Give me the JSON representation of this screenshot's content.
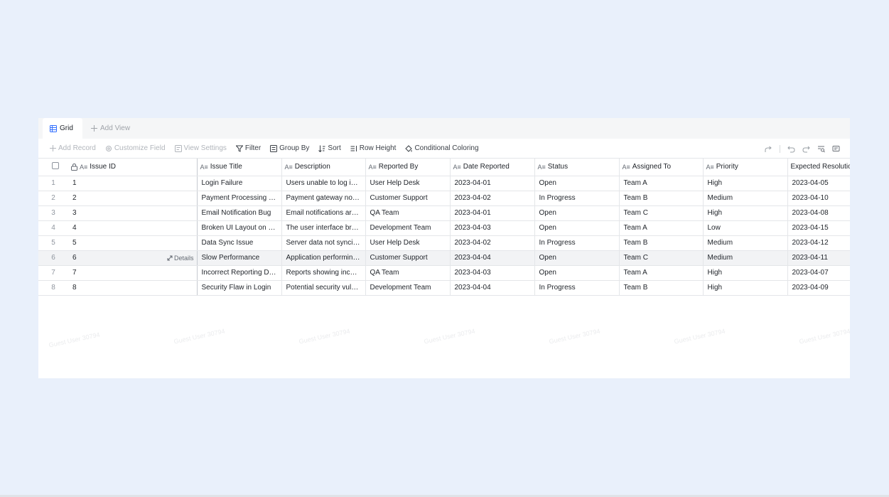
{
  "tabs": {
    "grid_label": "Grid",
    "add_view_label": "Add View"
  },
  "toolbar": {
    "add_record": "Add Record",
    "customize_field": "Customize Field",
    "view_settings": "View Settings",
    "filter": "Filter",
    "group_by": "Group By",
    "sort": "Sort",
    "row_height": "Row Height",
    "conditional_coloring": "Conditional Coloring"
  },
  "columns": {
    "issue_id": "Issue ID",
    "issue_title": "Issue Title",
    "description": "Description",
    "reported_by": "Reported By",
    "date_reported": "Date Reported",
    "status": "Status",
    "assigned_to": "Assigned To",
    "priority": "Priority",
    "expected_resolution": "Expected Resolution"
  },
  "details_label": "Details",
  "watermark_text": "Guest User 30794",
  "rows": [
    {
      "num": "1",
      "id": "1",
      "title": "Login Failure",
      "desc": "Users unable to log in u...",
      "rep": "User Help Desk",
      "date": "2023-04-01",
      "status": "Open",
      "assign": "Team A",
      "prio": "High",
      "exp": "2023-04-05"
    },
    {
      "num": "2",
      "id": "2",
      "title": "Payment Processing Er...",
      "desc": "Payment gateway not p...",
      "rep": "Customer Support",
      "date": "2023-04-02",
      "status": "In Progress",
      "assign": "Team B",
      "prio": "Medium",
      "exp": "2023-04-10"
    },
    {
      "num": "3",
      "id": "3",
      "title": "Email Notification Bug",
      "desc": "Email notifications are ...",
      "rep": "QA Team",
      "date": "2023-04-01",
      "status": "Open",
      "assign": "Team C",
      "prio": "High",
      "exp": "2023-04-08"
    },
    {
      "num": "4",
      "id": "4",
      "title": "Broken UI Layout on M...",
      "desc": "The user interface brea...",
      "rep": "Development Team",
      "date": "2023-04-03",
      "status": "Open",
      "assign": "Team A",
      "prio": "Low",
      "exp": "2023-04-15"
    },
    {
      "num": "5",
      "id": "5",
      "title": "Data Sync Issue",
      "desc": "Server data not syncin...",
      "rep": "User Help Desk",
      "date": "2023-04-02",
      "status": "In Progress",
      "assign": "Team B",
      "prio": "Medium",
      "exp": "2023-04-12"
    },
    {
      "num": "6",
      "id": "6",
      "title": "Slow Performance",
      "desc": "Application performing ...",
      "rep": "Customer Support",
      "date": "2023-04-04",
      "status": "Open",
      "assign": "Team C",
      "prio": "Medium",
      "exp": "2023-04-11"
    },
    {
      "num": "7",
      "id": "7",
      "title": "Incorrect Reporting Data",
      "desc": "Reports showing incorr...",
      "rep": "QA Team",
      "date": "2023-04-03",
      "status": "Open",
      "assign": "Team A",
      "prio": "High",
      "exp": "2023-04-07"
    },
    {
      "num": "8",
      "id": "8",
      "title": "Security Flaw in Login",
      "desc": "Potential security vulne...",
      "rep": "Development Team",
      "date": "2023-04-04",
      "status": "In Progress",
      "assign": "Team B",
      "prio": "High",
      "exp": "2023-04-09"
    }
  ],
  "colors": {
    "background": "#e9f0fb",
    "accent": "#3370ff",
    "border": "#e4e6e9",
    "row_highlight": "#f2f3f5"
  }
}
